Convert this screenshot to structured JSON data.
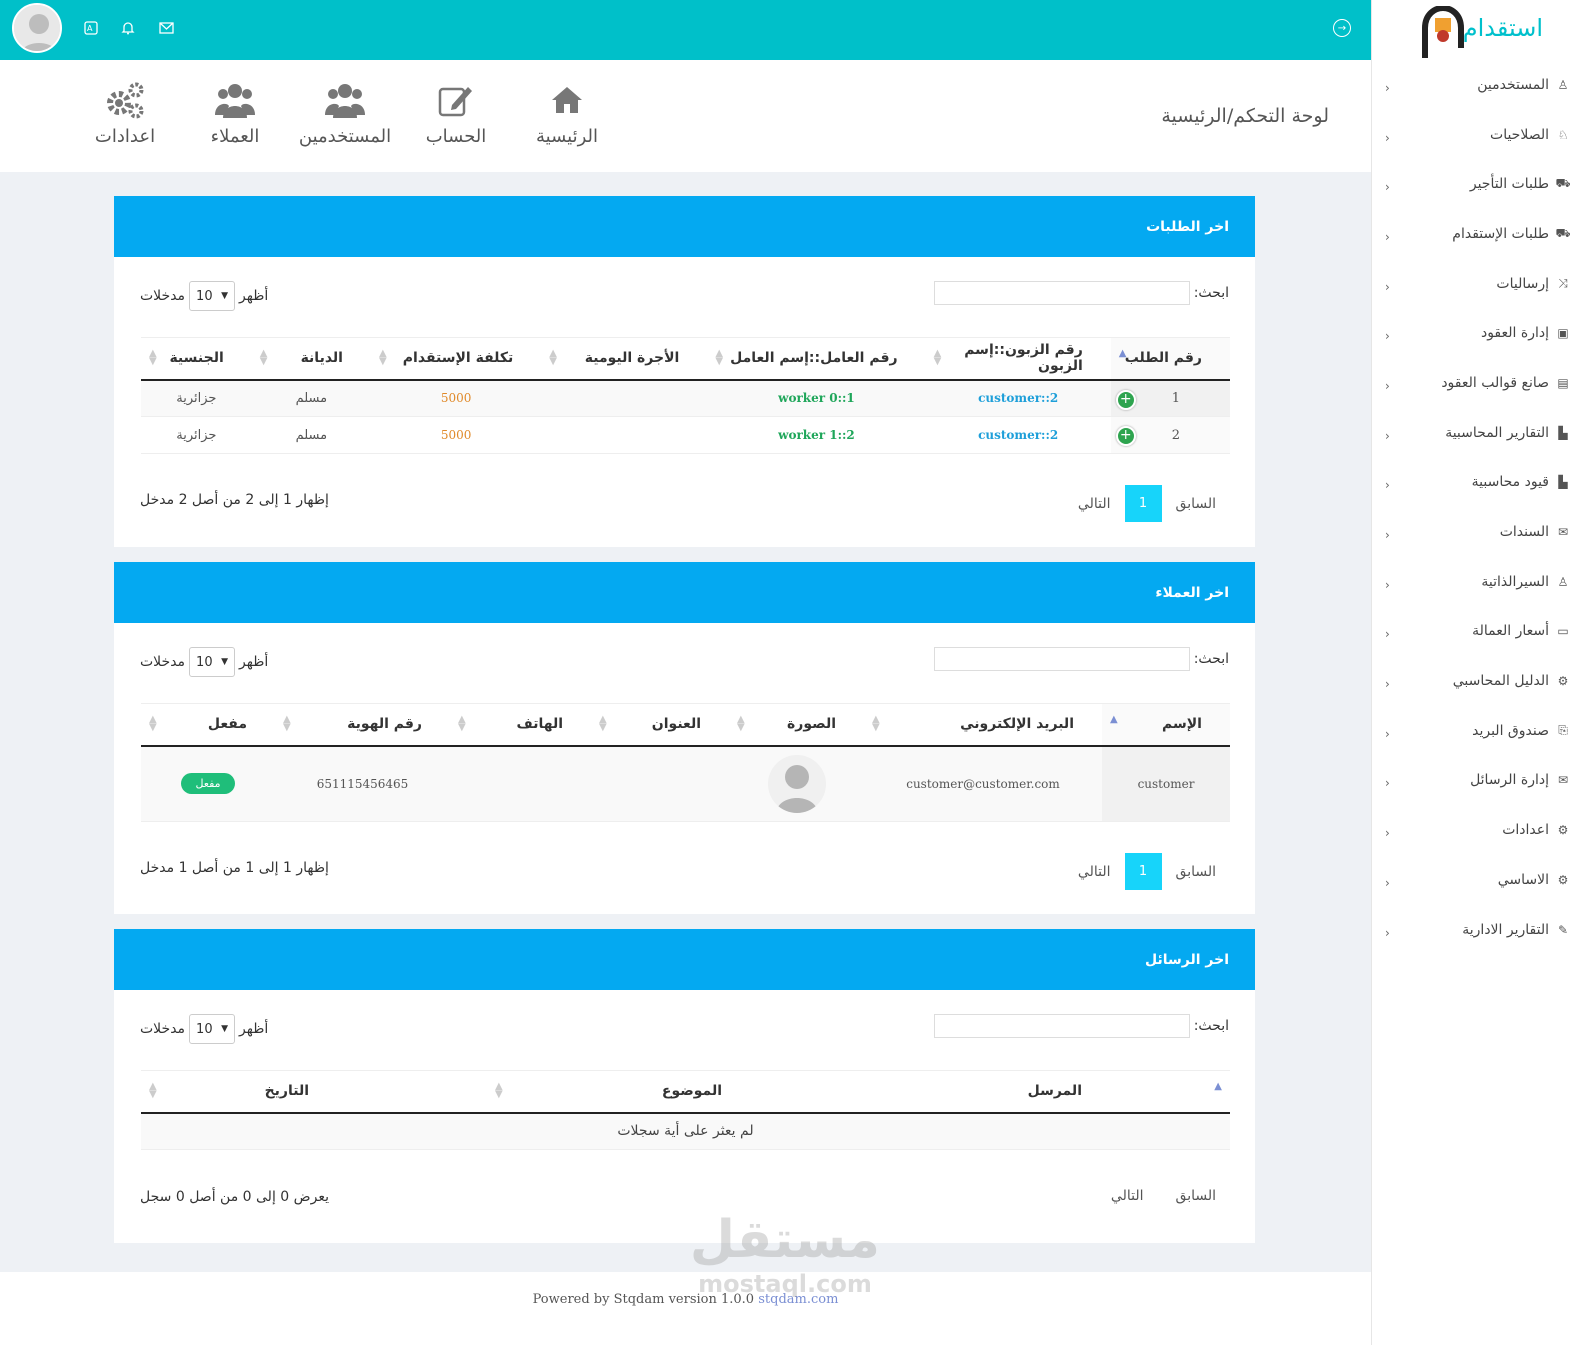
{
  "brand": {
    "name": "استقدام"
  },
  "sidebar": {
    "items": [
      {
        "label": "المستخدمين",
        "icon": "user-outline-icon"
      },
      {
        "label": "الصلاحيات",
        "icon": "award-icon"
      },
      {
        "label": "طلبات التأجير",
        "icon": "cart-icon"
      },
      {
        "label": "طلبات الإستقدام",
        "icon": "cart-icon"
      },
      {
        "label": "إرساليات",
        "icon": "shuffle-icon"
      },
      {
        "label": "إدارة العقود",
        "icon": "briefcase-icon"
      },
      {
        "label": "صانع قوالب العقود",
        "icon": "book-icon"
      },
      {
        "label": "التقارير المحاسبية",
        "icon": "file-icon"
      },
      {
        "label": "قيود محاسبية",
        "icon": "file-icon"
      },
      {
        "label": "السندات",
        "icon": "envelope-open-icon"
      },
      {
        "label": "السيرالذاتية",
        "icon": "user-outline-icon"
      },
      {
        "label": "أسعار العمالة",
        "icon": "money-icon"
      },
      {
        "label": "الدليل المحاسبي",
        "icon": "gears-icon"
      },
      {
        "label": "صندوق البريد",
        "icon": "inbox-icon"
      },
      {
        "label": "إدارة الرسائل",
        "icon": "envelope-open-icon"
      },
      {
        "label": "اعدادات",
        "icon": "gears-icon"
      },
      {
        "label": "الاساسي",
        "icon": "gears-icon"
      },
      {
        "label": "التقارير الادارية",
        "icon": "edit-icon"
      }
    ]
  },
  "header": {
    "title": "لوحة التحكم/الرئيسية",
    "quick_links": [
      {
        "label": "الرئيسية",
        "icon": "home-icon"
      },
      {
        "label": "الحساب",
        "icon": "edit-icon"
      },
      {
        "label": "المستخدمين",
        "icon": "users-icon"
      },
      {
        "label": "العملاء",
        "icon": "users-icon"
      },
      {
        "label": "اعدادات",
        "icon": "gears-icon"
      }
    ]
  },
  "common": {
    "search_label": "ابحث:",
    "show_label": "أظهر",
    "entries_label": "مدخلات",
    "page_length": "10",
    "prev_label": "السابق",
    "next_label": "التالي",
    "current_page": "1"
  },
  "orders": {
    "title": "اخر الطلبات",
    "columns": [
      "رقم الطلب",
      "رقم الزبون::إسم الزبون",
      "رقم العامل::إسم العامل",
      "الأجرة اليومية",
      "تكلفة الإستقدام",
      "الديانة",
      "الجنسية"
    ],
    "rows": [
      {
        "id": "1",
        "customer": "customer::2",
        "worker": "worker 0::1",
        "daily": "",
        "cost": "5000",
        "religion": "مسلم",
        "nationality": "جزائرية"
      },
      {
        "id": "2",
        "customer": "customer::2",
        "worker": "worker 1::2",
        "daily": "",
        "cost": "5000",
        "religion": "مسلم",
        "nationality": "جزائرية"
      }
    ],
    "info": "إظهار 1 إلى 2 من أصل 2 مدخل"
  },
  "customers": {
    "title": "اخر العملاء",
    "columns": [
      "الإسم",
      "البريد الإلكتروني",
      "الصورة",
      "العنوان",
      "الهاتف",
      "رقم الهوية",
      "مفعل"
    ],
    "rows": [
      {
        "name": "customer",
        "email": "customer@customer.com",
        "address": "",
        "phone": "",
        "id_number": "651115456465",
        "status": "مفعل"
      }
    ],
    "info": "إظهار 1 إلى 1 من أصل 1 مدخل"
  },
  "messages": {
    "title": "اخر الرسائل",
    "columns": [
      "المرسل",
      "الموضوع",
      "التاريخ"
    ],
    "empty": "لم يعثر على أية سجلات",
    "info": "يعرض 0 إلى 0 من أصل 0 سجل"
  },
  "footer": {
    "text": "Powered by Stqdam version 1.0.0",
    "link": "stqdam.com"
  },
  "watermark": {
    "line1": "مستقل",
    "line2": "mostaql.com"
  },
  "colors": {
    "topbar": "#00c0c9",
    "panel_header": "#04a9f1",
    "accent_green": "#1fbe5f",
    "link_blue": "#1e9fd9"
  }
}
